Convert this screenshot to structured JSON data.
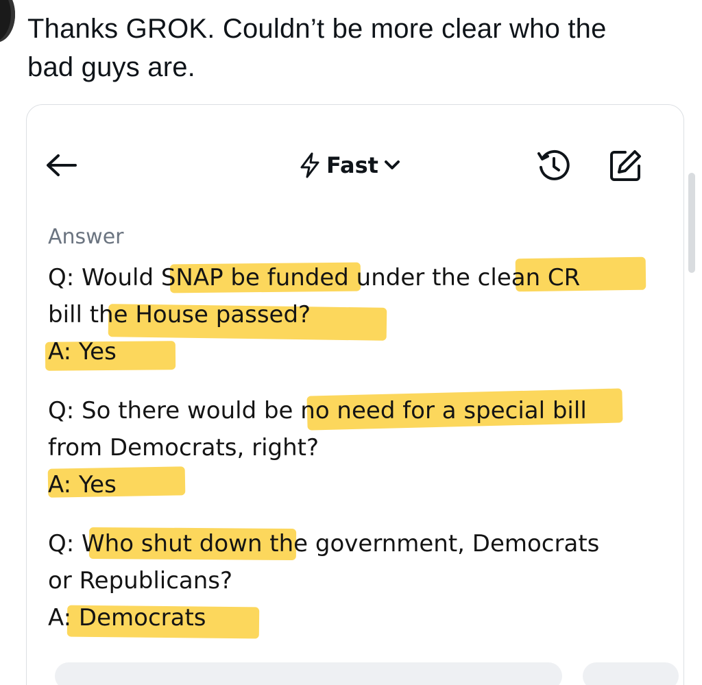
{
  "tweet": {
    "text_line1": "Thanks GROK. Couldn’t be more clear who the",
    "text_line2": "bad guys are."
  },
  "grok_ui": {
    "mode_label": "Fast",
    "answer_heading": "Answer",
    "qa": [
      {
        "q_line1": "Q: Would SNAP be funded under the clean CR",
        "q_line2": "bill the House passed?",
        "a": "A: Yes"
      },
      {
        "q_line1": "Q: So there would be no need for a special bill",
        "q_line2": "from Democrats, right?",
        "a": "A: Yes"
      },
      {
        "q_line1": "Q: Who shut down the government, Democrats",
        "q_line2": "or Republicans?",
        "a": "A: Democrats"
      }
    ]
  },
  "icons": {
    "back": "arrow-left-icon",
    "mode": "lightning-icon",
    "chevron": "chevron-down-icon",
    "history": "history-icon",
    "edit": "edit-icon"
  },
  "colors": {
    "highlight": "#fcd34a",
    "muted_text": "#6b7480",
    "text": "#0f1419",
    "card_border": "#dcdfe3"
  }
}
